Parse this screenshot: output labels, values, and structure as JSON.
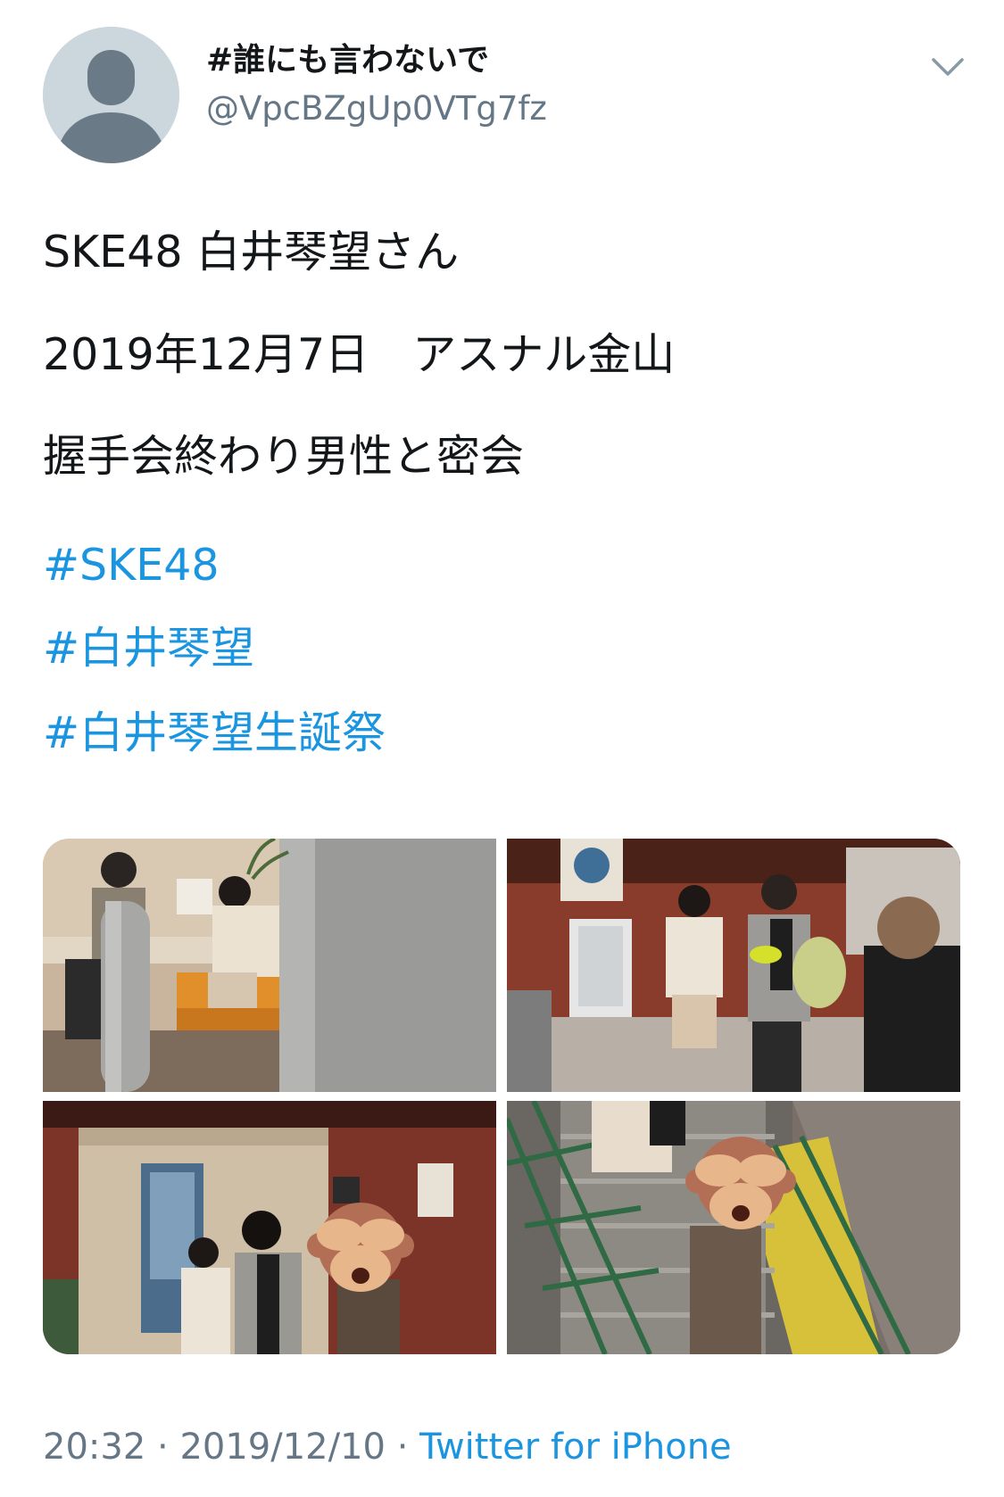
{
  "author": {
    "display_name": "#誰にも言わないで",
    "handle": "@VpcBZgUp0VTg7fz"
  },
  "tweet": {
    "lines": [
      "SKE48 白井琴望さん",
      "2019年12月7日　アスナル金山",
      "握手会終わり男性と密会"
    ],
    "hashtags": [
      "#SKE48",
      "#白井琴望",
      "#白井琴望生誕祭"
    ]
  },
  "media": {
    "count": 4,
    "overlay_icon": "see-no-evil-monkey-emoji"
  },
  "meta": {
    "time": "20:32",
    "separator": " · ",
    "date": "2019/12/10",
    "source": "Twitter for iPhone"
  },
  "colors": {
    "text": "#14171a",
    "secondary": "#657786",
    "link": "#1b95e0",
    "avatar_bg": "#ccd6dd",
    "avatar_fg": "#657786"
  }
}
